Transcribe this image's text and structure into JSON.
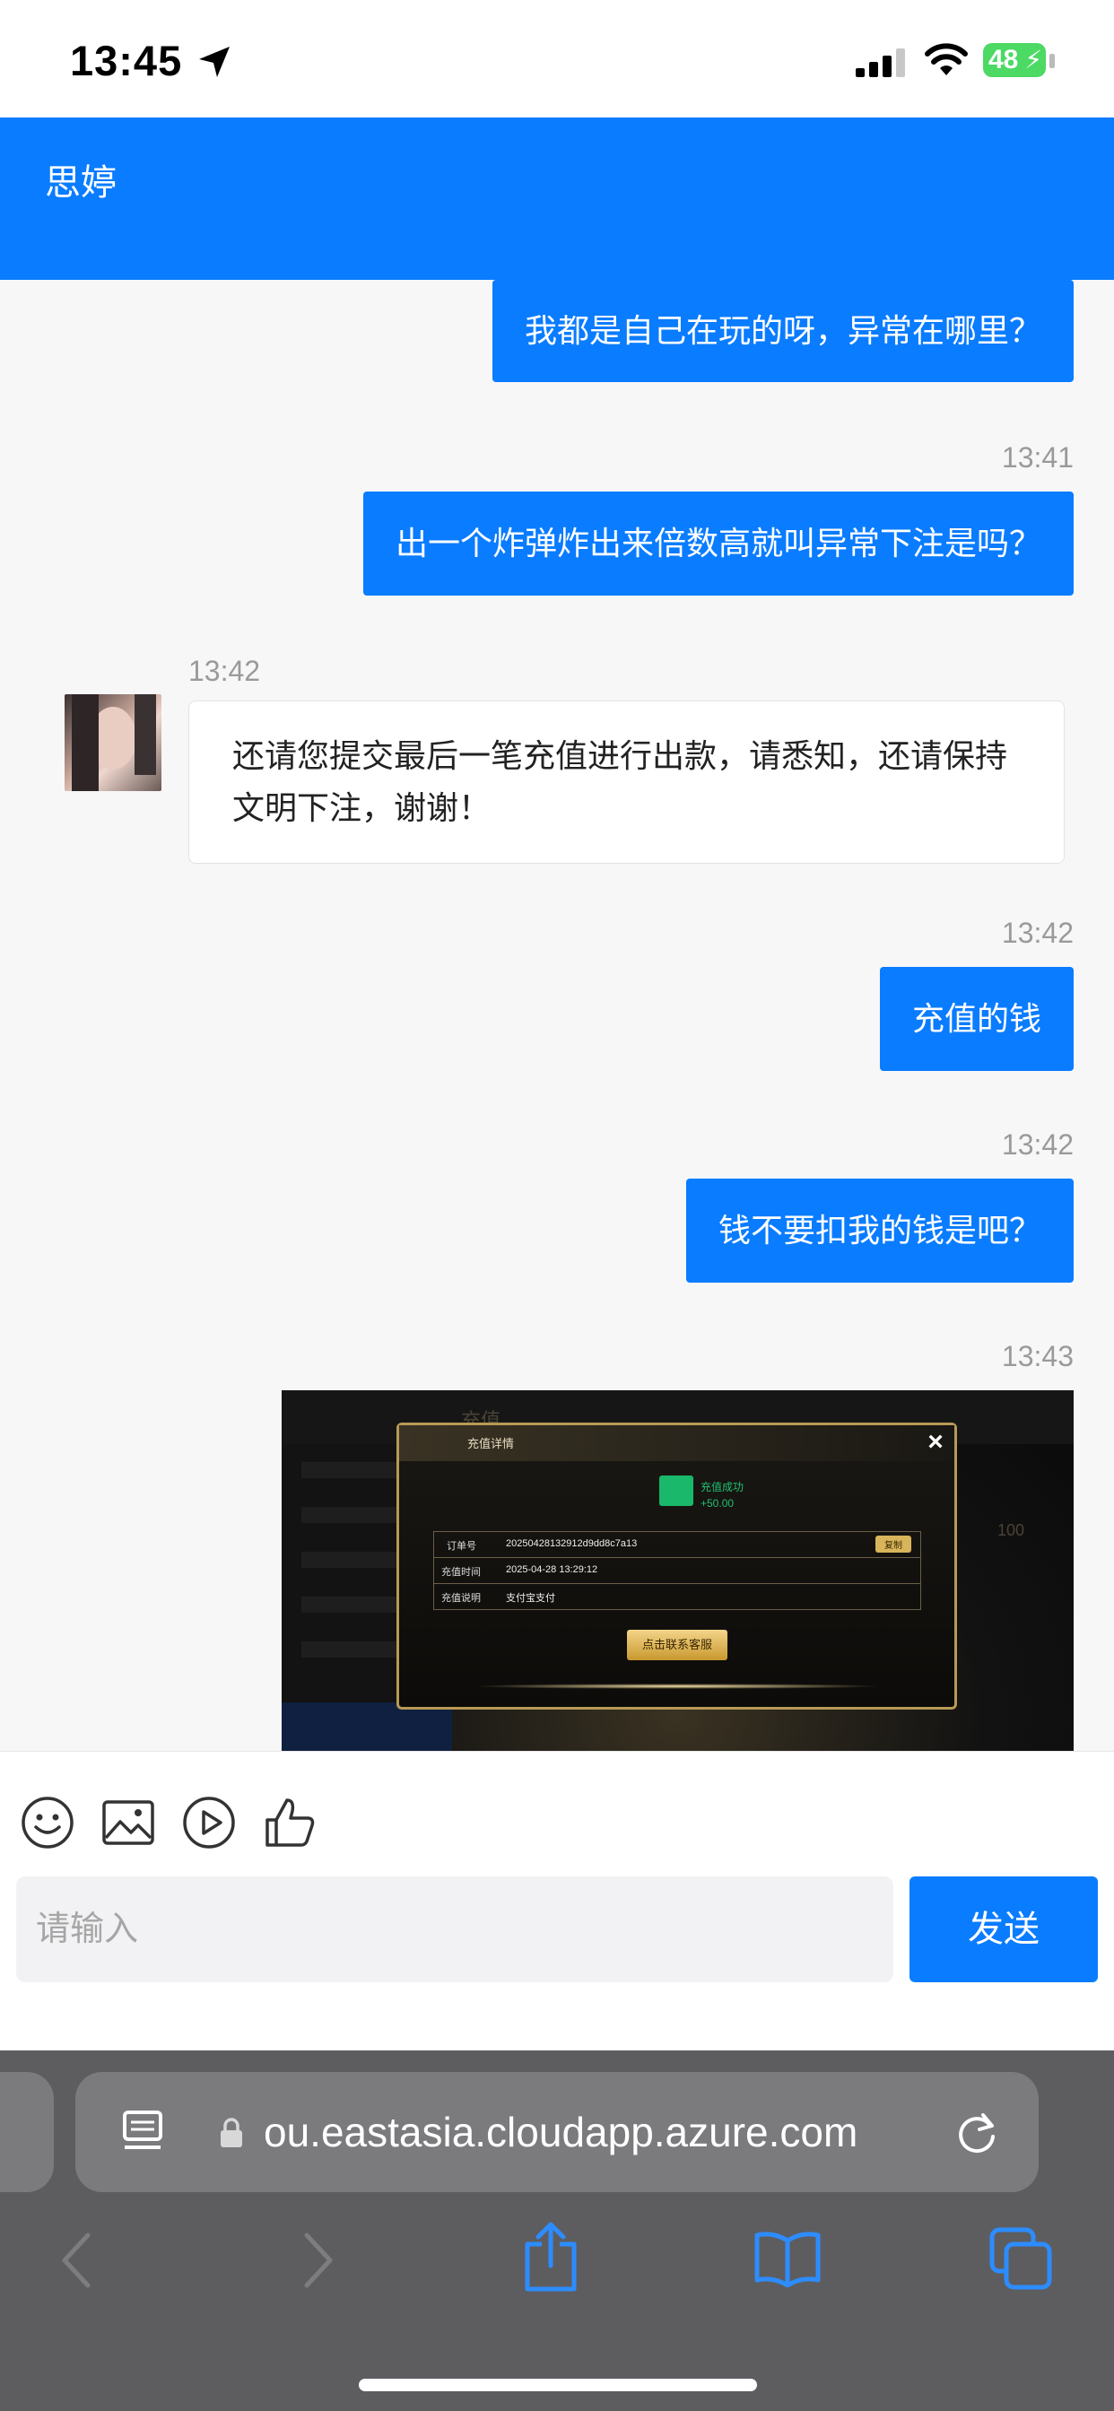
{
  "status_bar": {
    "time": "13:45",
    "battery": "48"
  },
  "header": {
    "contact_name": "思婷"
  },
  "messages": [
    {
      "side": "right",
      "text": "我都是自己在玩的呀，异常在哪里？"
    },
    {
      "side": "right",
      "time": "13:41",
      "text": "出一个炸弹炸出来倍数高就叫异常下注是吗？"
    },
    {
      "side": "left",
      "time": "13:42",
      "text": "还请您提交最后一笔充值进行出款，请悉知，还请保持文明下注，谢谢！"
    },
    {
      "side": "right",
      "time": "13:42",
      "text": "充值的钱"
    },
    {
      "side": "right",
      "time": "13:42",
      "text": "钱不要扣我的钱是吧？"
    },
    {
      "side": "right",
      "time": "13:43",
      "type": "image"
    }
  ],
  "screenshot": {
    "dialog_title": "充值详情",
    "status": "充值成功",
    "amount": "+50.00",
    "rows": [
      {
        "label": "订单号",
        "value": "20250428132912d9dd8c7a13",
        "action": "复制"
      },
      {
        "label": "充值时间",
        "value": "2025-04-28 13:29:12"
      },
      {
        "label": "充值说明",
        "value": "支付宝支付"
      }
    ],
    "button": "点击联系客服",
    "bg_texts": [
      "充值",
      "100"
    ]
  },
  "composer": {
    "placeholder": "请输入",
    "send": "发送"
  },
  "browser": {
    "url": "ou.eastasia.cloudapp.azure.com"
  }
}
